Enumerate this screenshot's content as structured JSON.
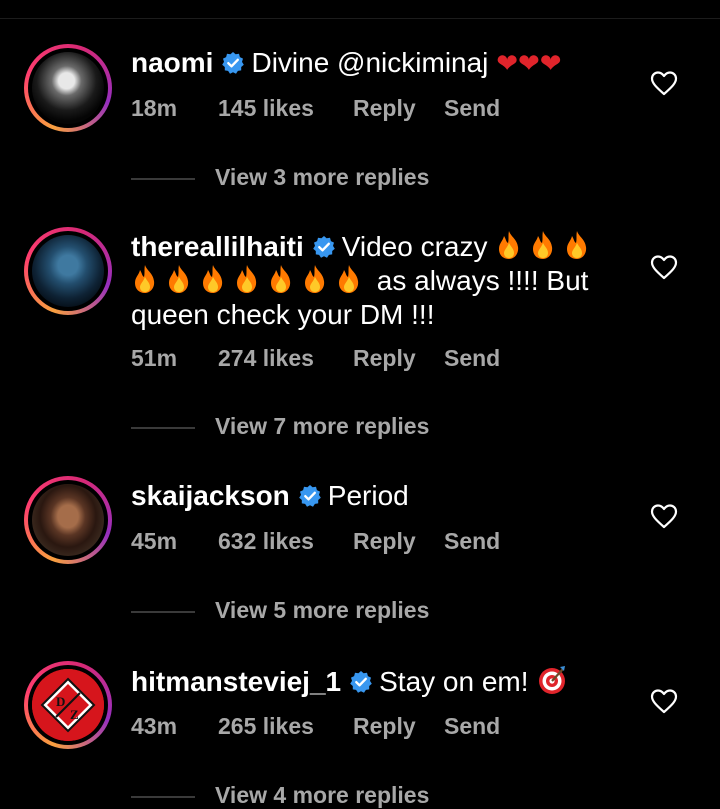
{
  "comments": [
    {
      "username": "naomi",
      "text": "Divine @nickiminaj",
      "emoji": "❤❤❤",
      "time": "18m",
      "likes": "145 likes",
      "reply": "Reply",
      "send": "Send",
      "more_replies": "View 3 more replies"
    },
    {
      "username": "thereallilhaiti",
      "text_a": "Video crazy",
      "text_b": "as always !!!! But",
      "text_c": "queen check your DM !!!",
      "time": "51m",
      "likes": "274 likes",
      "reply": "Reply",
      "send": "Send",
      "more_replies": "View 7 more replies"
    },
    {
      "username": "skaijackson",
      "text": "Period",
      "time": "45m",
      "likes": "632 likes",
      "reply": "Reply",
      "send": "Send",
      "more_replies": "View 5 more replies"
    },
    {
      "username": "hitmansteviej_1",
      "text": "Stay on em!",
      "avatar_text": "DZ",
      "time": "43m",
      "likes": "265 likes",
      "reply": "Reply",
      "send": "Send",
      "more_replies": "View 4 more replies"
    }
  ],
  "colors": {
    "background": "#000000",
    "meta": "#a8a8a8",
    "verified": "#3897f0",
    "heart": "#e0242b",
    "fire": "#ff7a00"
  }
}
